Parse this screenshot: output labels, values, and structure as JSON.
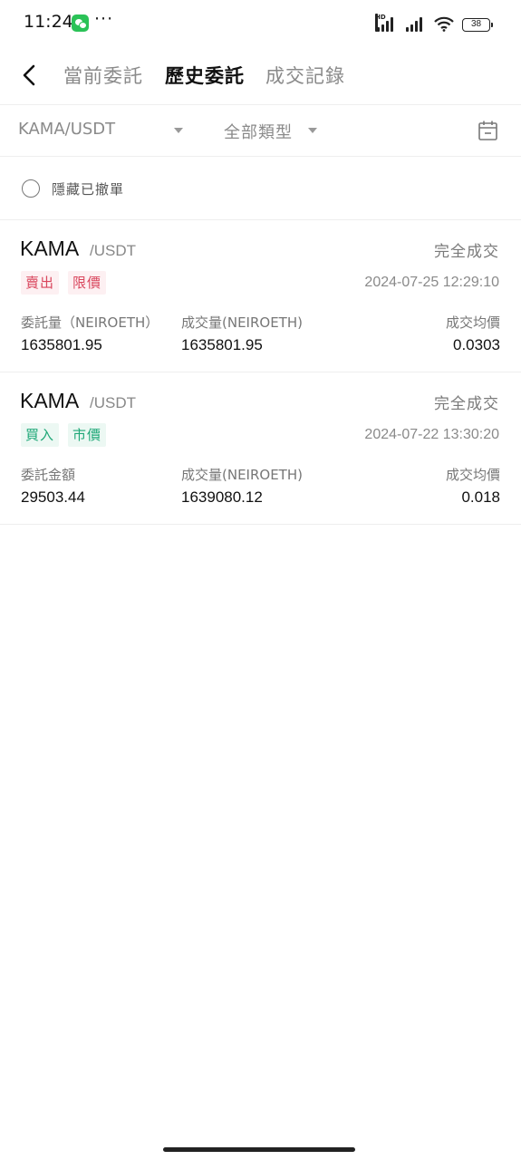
{
  "status_bar": {
    "time": "11:24",
    "dots": "···",
    "hd_label": "HD",
    "battery": "38"
  },
  "nav": {
    "tabs": [
      {
        "label": "當前委託"
      },
      {
        "label": "歷史委託"
      },
      {
        "label": "成交記錄"
      }
    ],
    "active_tab": 1
  },
  "filter": {
    "pair": "KAMA/USDT",
    "type": "全部類型"
  },
  "hide_cancelled": {
    "label": "隱藏已撤單"
  },
  "orders": [
    {
      "base": "KAMA",
      "quote": "/USDT",
      "status": "完全成交",
      "side": "賣出",
      "kind": "限價",
      "time": "2024-07-25 12:29:10",
      "col1_label": "委託量（NEIROETH）",
      "col1_value": "1635801.95",
      "col2_label": "成交量(NEIROETH)",
      "col2_value": "1635801.95",
      "col3_label": "成交均價",
      "col3_value": "0.0303"
    },
    {
      "base": "KAMA",
      "quote": "/USDT",
      "status": "完全成交",
      "side": "買入",
      "kind": "市價",
      "time": "2024-07-22 13:30:20",
      "col1_label": "委託金額",
      "col1_value": "29503.44",
      "col2_label": "成交量(NEIROETH)",
      "col2_value": "1639080.12",
      "col3_label": "成交均價",
      "col3_value": "0.018"
    }
  ],
  "colors": {
    "sell": "#d9465d",
    "buy": "#1ea777",
    "wechat": "#2bc257"
  }
}
